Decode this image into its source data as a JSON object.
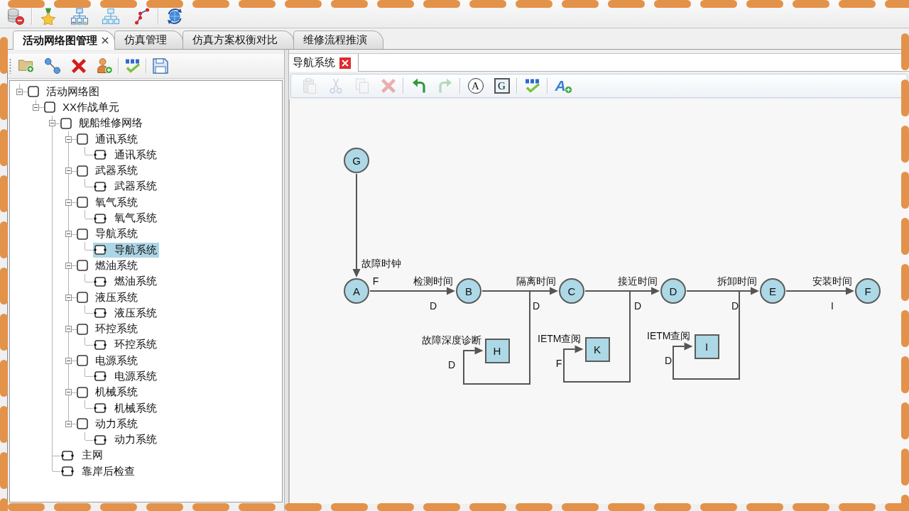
{
  "module_tabs": [
    {
      "label": "活动网络图管理",
      "selected": true,
      "closable": true
    },
    {
      "label": "仿真管理",
      "selected": false,
      "closable": false
    },
    {
      "label": "仿真方案权衡对比",
      "selected": false,
      "closable": false
    },
    {
      "label": "维修流程推演",
      "selected": false,
      "closable": false
    }
  ],
  "tree": [
    {
      "label": "活动网络图",
      "kind": "group",
      "expanded": true,
      "selected": false,
      "children": [
        {
          "label": "XX作战单元",
          "kind": "group",
          "expanded": true,
          "selected": false,
          "children": [
            {
              "label": "舰船维修网络",
              "kind": "group",
              "expanded": true,
              "selected": false,
              "children": [
                {
                  "label": "通讯系统",
                  "kind": "group",
                  "expanded": true,
                  "selected": false,
                  "children": [
                    {
                      "label": "通讯系统",
                      "kind": "leaf",
                      "selected": false
                    }
                  ]
                },
                {
                  "label": "武器系统",
                  "kind": "group",
                  "expanded": true,
                  "selected": false,
                  "children": [
                    {
                      "label": "武器系统",
                      "kind": "leaf",
                      "selected": false
                    }
                  ]
                },
                {
                  "label": "氧气系统",
                  "kind": "group",
                  "expanded": true,
                  "selected": false,
                  "children": [
                    {
                      "label": "氧气系统",
                      "kind": "leaf",
                      "selected": false
                    }
                  ]
                },
                {
                  "label": "导航系统",
                  "kind": "group",
                  "expanded": true,
                  "selected": false,
                  "children": [
                    {
                      "label": "导航系统",
                      "kind": "leaf",
                      "selected": true
                    }
                  ]
                },
                {
                  "label": "燃油系统",
                  "kind": "group",
                  "expanded": true,
                  "selected": false,
                  "children": [
                    {
                      "label": "燃油系统",
                      "kind": "leaf",
                      "selected": false
                    }
                  ]
                },
                {
                  "label": "液压系统",
                  "kind": "group",
                  "expanded": true,
                  "selected": false,
                  "children": [
                    {
                      "label": "液压系统",
                      "kind": "leaf",
                      "selected": false
                    }
                  ]
                },
                {
                  "label": "环控系统",
                  "kind": "group",
                  "expanded": true,
                  "selected": false,
                  "children": [
                    {
                      "label": "环控系统",
                      "kind": "leaf",
                      "selected": false
                    }
                  ]
                },
                {
                  "label": "电源系统",
                  "kind": "group",
                  "expanded": true,
                  "selected": false,
                  "children": [
                    {
                      "label": "电源系统",
                      "kind": "leaf",
                      "selected": false
                    }
                  ]
                },
                {
                  "label": "机械系统",
                  "kind": "group",
                  "expanded": true,
                  "selected": false,
                  "children": [
                    {
                      "label": "机械系统",
                      "kind": "leaf",
                      "selected": false
                    }
                  ]
                },
                {
                  "label": "动力系统",
                  "kind": "group",
                  "expanded": true,
                  "selected": false,
                  "children": [
                    {
                      "label": "动力系统",
                      "kind": "leaf",
                      "selected": false
                    }
                  ]
                }
              ]
            },
            {
              "label": "主网",
              "kind": "leaf",
              "selected": false
            },
            {
              "label": "靠岸后检查",
              "kind": "leaf",
              "selected": false
            }
          ]
        }
      ]
    }
  ],
  "document_tabs": [
    {
      "label": "导航系统",
      "selected": true,
      "closable": true
    }
  ],
  "editor_toolbar": {
    "buttons": [
      {
        "disabled": true
      },
      {
        "disabled": true
      },
      {
        "disabled": true
      },
      {
        "disabled": true
      },
      {
        "disabled": false
      },
      {
        "disabled": true
      },
      {
        "label": "A",
        "disabled": false
      },
      {
        "label": "G",
        "disabled": false
      },
      {
        "disabled": false
      },
      {
        "label": "A",
        "disabled": false
      }
    ]
  },
  "network": {
    "source": {
      "node": "G",
      "label": "故障时钟"
    },
    "chain": [
      "A",
      "B",
      "C",
      "D",
      "E",
      "F"
    ],
    "links": [
      {
        "label": "检测时间",
        "code": "D",
        "start_code": "F"
      },
      {
        "label": "隔离时间",
        "code": "D",
        "loop": {
          "node": "H",
          "label": "故障深度诊断",
          "code": "D"
        }
      },
      {
        "label": "接近时间",
        "code": "D",
        "loop": {
          "node": "K",
          "label": "IETM查阅",
          "code": "F"
        }
      },
      {
        "label": "拆卸时间",
        "code": "D",
        "loop": {
          "node": "I",
          "label": "IETM查阅",
          "code": "D"
        }
      },
      {
        "label": "安装时间",
        "code": "I"
      }
    ]
  }
}
